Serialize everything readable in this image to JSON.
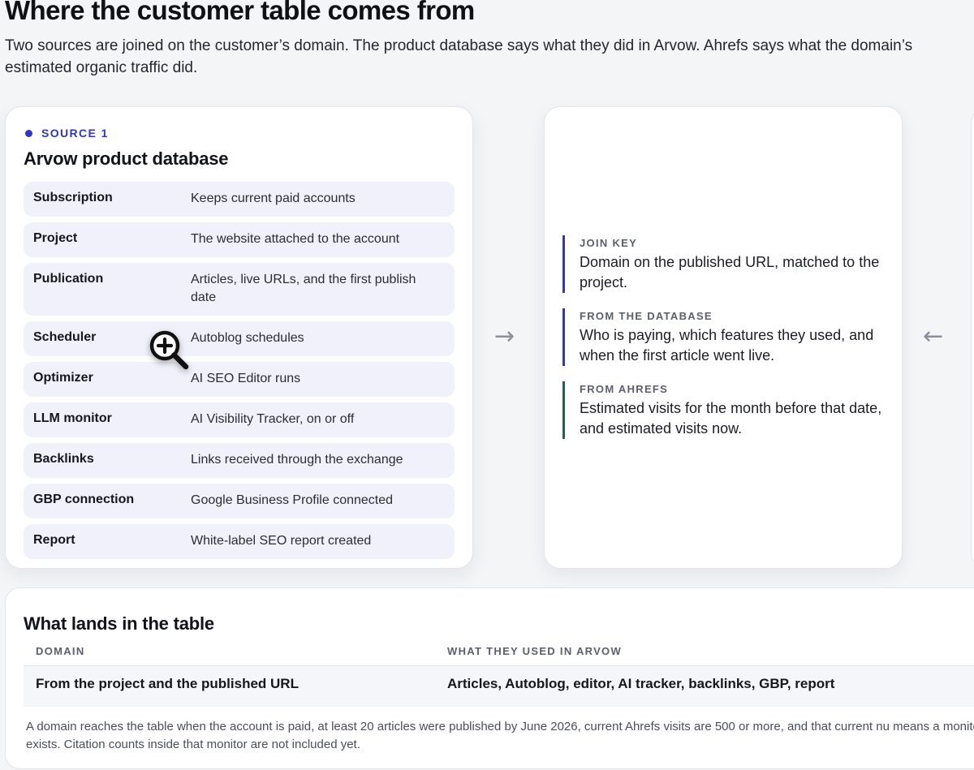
{
  "page": {
    "title": "Where the customer table comes from",
    "intro": "Two sources are joined on the customer’s domain. The product database says what they did in Arvow. Ahrefs says what the domain’s estimated organic traffic did."
  },
  "source": {
    "eyebrow": "SOURCE 1",
    "title": "Arvow product database",
    "rows": [
      {
        "name": "Subscription",
        "desc": "Keeps current paid accounts"
      },
      {
        "name": "Project",
        "desc": "The website attached to the account"
      },
      {
        "name": "Publication",
        "desc": "Articles, live URLs, and the first publish date"
      },
      {
        "name": "Scheduler",
        "desc": "Autoblog schedules"
      },
      {
        "name": "Optimizer",
        "desc": "AI SEO Editor runs"
      },
      {
        "name": "LLM monitor",
        "desc": "AI Visibility Tracker, on or off"
      },
      {
        "name": "Backlinks",
        "desc": "Links received through the exchange"
      },
      {
        "name": "GBP connection",
        "desc": "Google Business Profile connected"
      },
      {
        "name": "Report",
        "desc": "White-label SEO report created"
      }
    ]
  },
  "join": {
    "blocks": [
      {
        "label": "JOIN KEY",
        "text": "Domain on the published URL, matched to the project."
      },
      {
        "label": "FROM THE DATABASE",
        "text": "Who is paying, which features they used, and when the first article went live."
      },
      {
        "label": "FROM AHREFS",
        "text": "Estimated visits for the month before that date, and estimated visits now."
      }
    ]
  },
  "lands": {
    "title": "What lands in the table",
    "columns": [
      "DOMAIN",
      "WHAT THEY USED IN ARVOW"
    ],
    "row": [
      "From the project and the published URL",
      "Articles, Autoblog, editor, AI tracker, backlinks, GBP, report"
    ],
    "footnote": "A domain reaches the table when the account is paid, at least 20 articles were published by June 2026, current Ahrefs visits are 500 or more, and that current nu means a monitor exists. Citation counts inside that monitor are not included yet."
  },
  "icons": {
    "arrow_right": "→",
    "arrow_left": "←",
    "cursor": "zoom-in-icon"
  },
  "colors": {
    "accent_blue": "#2f35c8",
    "accent_green": "#14684e",
    "row_bg": "#f1f1fb"
  }
}
